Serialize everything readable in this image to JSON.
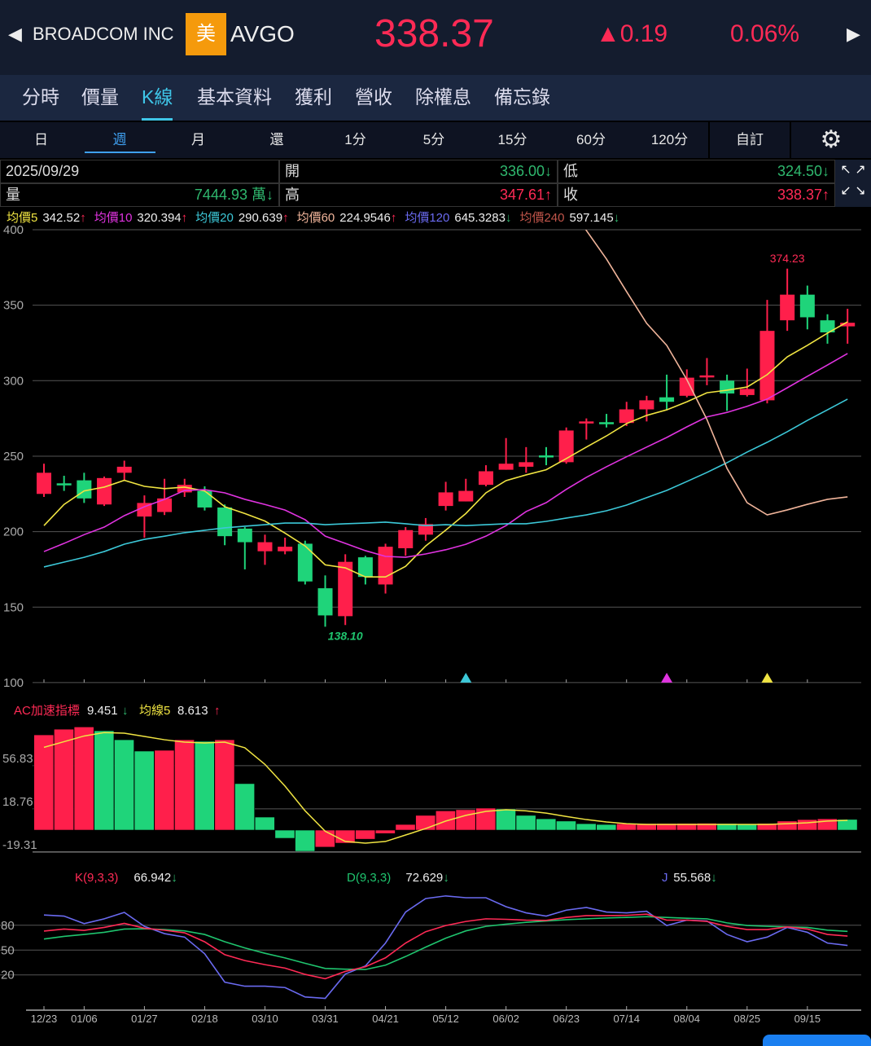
{
  "header": {
    "back_icon": "triangle-left",
    "company": "BROADCOM INC",
    "market_badge": "美",
    "symbol": "AVGO",
    "price": "338.37",
    "change": "▲0.19",
    "change_pct": "0.06%",
    "next_icon": "triangle-right"
  },
  "tabs": [
    "分時",
    "價量",
    "K線",
    "基本資料",
    "獲利",
    "營收",
    "除權息",
    "備忘錄"
  ],
  "active_tab": 2,
  "periods": [
    "日",
    "週",
    "月",
    "還",
    "1分",
    "5分",
    "15分",
    "60分",
    "120分"
  ],
  "active_period": 1,
  "custom_label": "自訂",
  "settings_icon": "gear-icon",
  "info": {
    "date": "2025/09/29",
    "open_label": "開",
    "open": "336.00↓",
    "low_label": "低",
    "low": "324.50↓",
    "vol_label": "量",
    "vol": "7444.93 萬↓",
    "high_label": "高",
    "high": "347.61↑",
    "close_label": "收",
    "close": "338.37↑"
  },
  "ma_legend": [
    {
      "label": "均價5",
      "value": "342.52",
      "arrow": "↑",
      "color": "#f0e442"
    },
    {
      "label": "均價10",
      "value": "320.394",
      "arrow": "↑",
      "color": "#e033e0"
    },
    {
      "label": "均價20",
      "value": "290.639",
      "arrow": "↑",
      "color": "#3cc8d8"
    },
    {
      "label": "均價60",
      "value": "224.9546",
      "arrow": "↑",
      "color": "#f0b49a"
    },
    {
      "label": "均價120",
      "value": "645.3283",
      "arrow": "↓",
      "color": "#6a6af0"
    },
    {
      "label": "均價240",
      "value": "597.145",
      "arrow": "↓",
      "color": "#c0554a"
    }
  ],
  "colors": {
    "up": "#ff1f4b",
    "down": "#1fd47a",
    "grid": "#555"
  },
  "chart_data": [
    {
      "type": "candlestick",
      "title": "K線 週",
      "ylim": [
        100,
        400
      ],
      "yticks": [
        400,
        350,
        300,
        250,
        200,
        150,
        100
      ],
      "x_labels": [
        {
          "i": 0,
          "t": "12/23"
        },
        {
          "i": 2,
          "t": "01/06"
        },
        {
          "i": 5,
          "t": "01/27"
        },
        {
          "i": 8,
          "t": "02/18"
        },
        {
          "i": 11,
          "t": "03/10"
        },
        {
          "i": 14,
          "t": "03/31"
        },
        {
          "i": 17,
          "t": "04/21"
        },
        {
          "i": 20,
          "t": "05/12"
        },
        {
          "i": 23,
          "t": "06/02"
        },
        {
          "i": 26,
          "t": "06/23"
        },
        {
          "i": 29,
          "t": "07/14"
        },
        {
          "i": 32,
          "t": "08/04"
        },
        {
          "i": 35,
          "t": "08/25"
        },
        {
          "i": 38,
          "t": "09/15"
        }
      ],
      "ohlc": [
        [
          225,
          245,
          223,
          239
        ],
        [
          232,
          237,
          227,
          231
        ],
        [
          234,
          239,
          219,
          222
        ],
        [
          218,
          236.5,
          217,
          235.5
        ],
        [
          239,
          247,
          234,
          243
        ],
        [
          210,
          224,
          196,
          219
        ],
        [
          213,
          235,
          211,
          222
        ],
        [
          226,
          235,
          223,
          231
        ],
        [
          227,
          230,
          214,
          216
        ],
        [
          216,
          218,
          191,
          197
        ],
        [
          202,
          203,
          175,
          193
        ],
        [
          187,
          198,
          178,
          193
        ],
        [
          187,
          196,
          185,
          190
        ],
        [
          192,
          194,
          165,
          167
        ],
        [
          162.5,
          171,
          137,
          144.5
        ],
        [
          144,
          185,
          138.1,
          180
        ],
        [
          183,
          184,
          165,
          170
        ],
        [
          165,
          192,
          159,
          190
        ],
        [
          189,
          203,
          184,
          201
        ],
        [
          198,
          209,
          194,
          205
        ],
        [
          217,
          233,
          214,
          226
        ],
        [
          220,
          235,
          220,
          227
        ],
        [
          231,
          244,
          230,
          240
        ],
        [
          241,
          262,
          241,
          245
        ],
        [
          243,
          256,
          239,
          246
        ],
        [
          250.5,
          256,
          244,
          250
        ],
        [
          246,
          269,
          245,
          267
        ],
        [
          272,
          275,
          261,
          273
        ],
        [
          272.5,
          278,
          269,
          272
        ],
        [
          272,
          286,
          270,
          281
        ],
        [
          281,
          290,
          273,
          287
        ],
        [
          289,
          304,
          281,
          286
        ],
        [
          290,
          307.5,
          289,
          302
        ],
        [
          303,
          315,
          297,
          303.5
        ],
        [
          300,
          304,
          280,
          291.5
        ],
        [
          290.5,
          308,
          289.5,
          294.5
        ],
        [
          287,
          353.5,
          285,
          333
        ],
        [
          340,
          374.23,
          333,
          357
        ],
        [
          357,
          363,
          334,
          342
        ],
        [
          340,
          344,
          324.5,
          332
        ],
        [
          336,
          347.61,
          324.5,
          338.37
        ]
      ],
      "annotations": {
        "high": {
          "i": 37,
          "t": "374.23"
        },
        "low": {
          "i": 15,
          "t": "138.10"
        }
      },
      "signals": [
        {
          "i": 21,
          "color": "#3cc8d8"
        },
        {
          "i": 31,
          "color": "#e033e0"
        },
        {
          "i": 36,
          "color": "#f0e442"
        }
      ],
      "ma": [
        {
          "name": "均價5",
          "color": "#f0e442",
          "start": 0,
          "values": [
            204,
            218,
            227,
            229.5,
            234,
            230,
            228.5,
            229.5,
            227,
            216.5,
            212,
            207,
            199,
            190.5,
            178,
            176,
            170,
            170,
            177,
            190.5,
            201,
            212,
            225.7,
            233.8,
            237.6,
            241,
            248.4,
            256,
            263.4,
            271.6,
            277,
            280.7,
            286,
            292,
            293.7,
            295.8,
            304,
            315.8,
            323.4,
            331.5,
            339
          ]
        },
        {
          "name": "均價10",
          "color": "#e033e0",
          "start": 0,
          "values": [
            186.8,
            192.2,
            198,
            203,
            210.6,
            216.5,
            221.4,
            227.3,
            227.8,
            225.7,
            221.4,
            218,
            214.3,
            207.9,
            197,
            192.2,
            187.4,
            183.6,
            183,
            185.2,
            188,
            191.6,
            197,
            204,
            213.3,
            219.2,
            228,
            236,
            243,
            249.6,
            256,
            262.4,
            269.4,
            276,
            279,
            283,
            287.8,
            295.3,
            302.9,
            310.4,
            318
          ]
        },
        {
          "name": "均價20",
          "color": "#3cc8d8",
          "start": 0,
          "values": [
            176.6,
            179.8,
            183,
            186.8,
            191.7,
            194.9,
            197,
            199.3,
            200.9,
            202.5,
            203.6,
            204.6,
            205.7,
            205.7,
            204.6,
            205.2,
            205.7,
            206.3,
            205.2,
            204,
            204.6,
            204,
            204.6,
            205.2,
            205.2,
            206.8,
            209,
            211.1,
            213.8,
            217.6,
            222.5,
            227.3,
            233.2,
            239.2,
            245.7,
            252.7,
            259.2,
            266.2,
            273.7,
            280.7,
            287.8
          ]
        },
        {
          "name": "均價60",
          "color": "#f0b49a",
          "start": 26,
          "values": [
            420,
            399.5,
            380.6,
            359,
            338,
            323.4,
            300.7,
            274.3,
            241.9,
            219.2,
            211.1,
            214.4,
            218.1,
            221.4,
            223
          ]
        }
      ]
    },
    {
      "type": "bar",
      "title": "AC加速指標",
      "label": "AC加速指標",
      "value": "9.451",
      "arrow": "↓",
      "ma_label": "均線5",
      "ma_value": "8.613",
      "ma_arrow": "↑",
      "yticks": [
        {
          "v": 56.83,
          "t": "56.83"
        },
        {
          "v": 18.76,
          "t": "18.76"
        },
        {
          "v": -19.31,
          "t": "-19.31"
        }
      ],
      "values": [
        84,
        89,
        91,
        87.6,
        79.7,
        69.7,
        70.4,
        79.7,
        78.3,
        79.7,
        41,
        11.5,
        -7.2,
        -18.7,
        -15,
        -11.5,
        -8,
        -3,
        5,
        13,
        17,
        18,
        19.4,
        18.7,
        13,
        10,
        8,
        5.7,
        5,
        5.7,
        5.8,
        5.9,
        6.0,
        6.1,
        5.8,
        5.6,
        6.0,
        8,
        9.3,
        10,
        9.451
      ],
      "ma5": [
        73,
        78,
        83,
        86,
        85.5,
        82.6,
        79.7,
        77.6,
        76.9,
        77.6,
        72.6,
        58,
        38.8,
        17,
        -1,
        -10,
        -11.5,
        -10,
        -4.3,
        1.4,
        8,
        13,
        16.5,
        18,
        17,
        15,
        12,
        9.3,
        7.2,
        5.7,
        5,
        5,
        5,
        5,
        5,
        5,
        5,
        5.7,
        6.5,
        8,
        8.613
      ]
    },
    {
      "type": "line",
      "title": "KDJ",
      "yticks": [
        80,
        50,
        20
      ],
      "series": [
        {
          "name": "K(9,3,3)",
          "value": "66.942",
          "arrow": "↓",
          "color": "#ff2a55",
          "values": [
            73,
            75.4,
            73.8,
            77.4,
            82.3,
            76.4,
            74,
            70.9,
            60,
            44.4,
            37.3,
            32.4,
            28.2,
            20.6,
            15.4,
            24.2,
            29.8,
            40.6,
            58.5,
            72.2,
            79.7,
            84.6,
            87.8,
            87.2,
            86.2,
            85.9,
            89.5,
            91.7,
            91.7,
            92,
            93.4,
            86.2,
            86.2,
            84.6,
            78.7,
            74.8,
            74.8,
            78,
            75.4,
            68.9,
            66.942
          ]
        },
        {
          "name": "D(9,3,3)",
          "value": "72.629",
          "arrow": "↓",
          "color": "#1fc46e",
          "values": [
            63.4,
            66.6,
            68.9,
            71.5,
            75.4,
            75.8,
            74.8,
            73.2,
            68.9,
            60.1,
            52.6,
            46.1,
            40.5,
            34,
            27.8,
            26.9,
            26.5,
            31.8,
            42.2,
            53.6,
            64.4,
            73.2,
            78.7,
            81.3,
            83.6,
            85.2,
            86.8,
            87.8,
            88.8,
            89.5,
            90.4,
            89.5,
            88.5,
            87.8,
            82.9,
            79.7,
            78.7,
            78,
            77.4,
            74.1,
            72.629
          ]
        },
        {
          "name": "J",
          "value": "55.568",
          "arrow": "↓",
          "color": "#6a6af0",
          "values": [
            92.4,
            91.1,
            82,
            87.8,
            95.6,
            78.7,
            69.9,
            65.7,
            45.5,
            11.2,
            6.3,
            6.3,
            4.7,
            -6.7,
            -8.4,
            21,
            30.8,
            58.5,
            96,
            112.3,
            115.5,
            113.3,
            113.3,
            102.5,
            95,
            91.1,
            98.3,
            101.5,
            96,
            95,
            97,
            79.7,
            86.2,
            85.2,
            68.9,
            60.1,
            65.7,
            77.4,
            71.5,
            58.5,
            55.568
          ]
        }
      ]
    }
  ]
}
